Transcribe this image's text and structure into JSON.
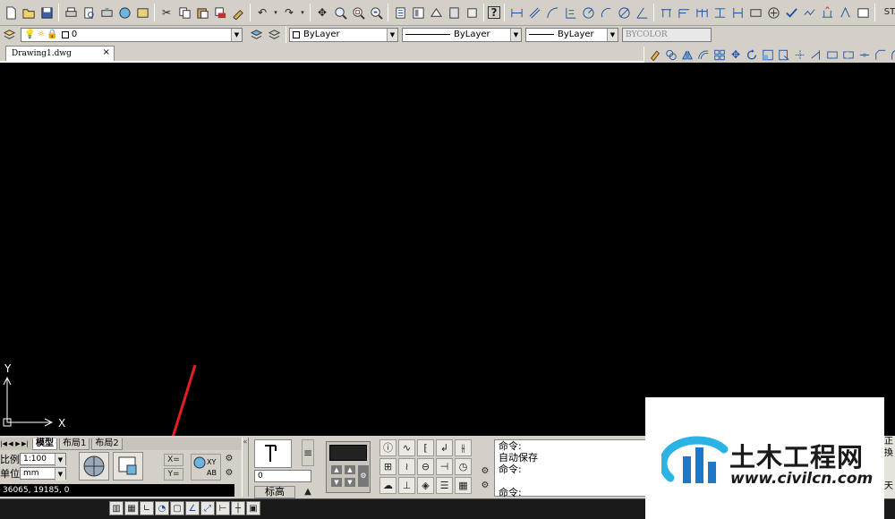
{
  "app": {
    "doc_tab": "Drawing1.dwg",
    "doc_tab_close": "×"
  },
  "toolbar2": {
    "layer_value": "0",
    "color_value": "ByLayer",
    "linetype_value": "ByLayer",
    "lineweight_value": "ByLayer",
    "plotstyle_value": "BYCOLOR",
    "style_label": "STA"
  },
  "ucs": {
    "y_label": "Y",
    "x_label": "X"
  },
  "layout_tabs": [
    "模型",
    "布局1",
    "布局2"
  ],
  "scale_panel": {
    "scale_label": "比例",
    "scale_value": "1:100",
    "unit_label": "单位",
    "unit_value": "mm"
  },
  "coords": "36065,  19185,  0",
  "dim_panel": {
    "input_value": "0",
    "tag_label": "标高"
  },
  "command_window": {
    "lines": [
      "命令:",
      "自动保存",
      "命令:",
      "",
      "命令:"
    ]
  },
  "watermark": {
    "title": "土木工程网",
    "url": "www.civilcn.com"
  },
  "right_strip": [
    "正",
    "換",
    "天"
  ],
  "colors": {
    "accent_blue": "#1c4f9c",
    "logo_blue": "#1e78c8",
    "logo_cyan": "#2bb3e6",
    "arrow_red": "#e02020"
  }
}
